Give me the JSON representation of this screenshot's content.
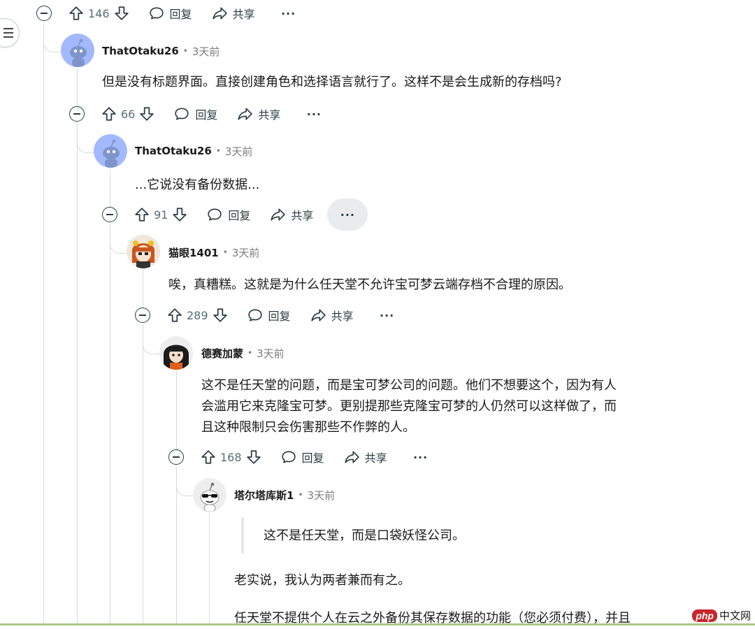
{
  "comments": [
    {
      "author": "ThatOtaku26",
      "time": "3天前",
      "text": "但是没有标题界面。直接创建角色和选择语言就行了。这样不是会生成新的存档吗?"
    },
    {
      "author": "ThatOtaku26",
      "time": "3天前",
      "text": "...它说没有备份数据..."
    },
    {
      "author": "猫眼1401",
      "time": "3天前",
      "text": "唉，真糟糕。这就是为什么任天堂不允许宝可梦云端存档不合理的原因。"
    },
    {
      "author": "德赛加蒙",
      "time": "3天前",
      "lines": [
        "这不是任天堂的问题，而是宝可梦公司的问题。他们不想要这个，因为有人",
        "会滥用它来克隆宝可梦。更别提那些克隆宝可梦的人仍然可以这样做了，而",
        "且这种限制只会伤害那些不作弊的人。"
      ]
    },
    {
      "author": "塔尔塔库斯1",
      "time": "3天前",
      "quote": "这不是任天堂，而是口袋妖怪公司。",
      "para1": "老实说，我认为两者兼而有之。",
      "para2": "任天堂不提供个人在云之外备份其保存数据的功能（您必须付费），并且"
    }
  ],
  "action_rows": [
    {
      "score": "146",
      "reply": "回复",
      "share": "共享",
      "more": "···"
    },
    {
      "score": "66",
      "reply": "回复",
      "share": "共享",
      "more": "···"
    },
    {
      "score": "91",
      "reply": "回复",
      "share": "共享",
      "more": "···"
    },
    {
      "score": "289",
      "reply": "回复",
      "share": "共享",
      "more": "···"
    },
    {
      "score": "168",
      "reply": "回复",
      "share": "共享",
      "more": "···"
    }
  ],
  "dot": "•",
  "watermark": {
    "php": "php",
    "cn": "中文网"
  },
  "colors": {
    "meta": "#7c7c7c",
    "thread_line": "#d6dadc",
    "action": "#576f76",
    "avatar_blue": "#a3b9ff"
  },
  "icons": [
    "collapse-icon",
    "upvote-icon",
    "downvote-icon",
    "reply-icon",
    "share-icon",
    "more-icon",
    "menu-icon",
    "reddit-avatar-icon"
  ]
}
